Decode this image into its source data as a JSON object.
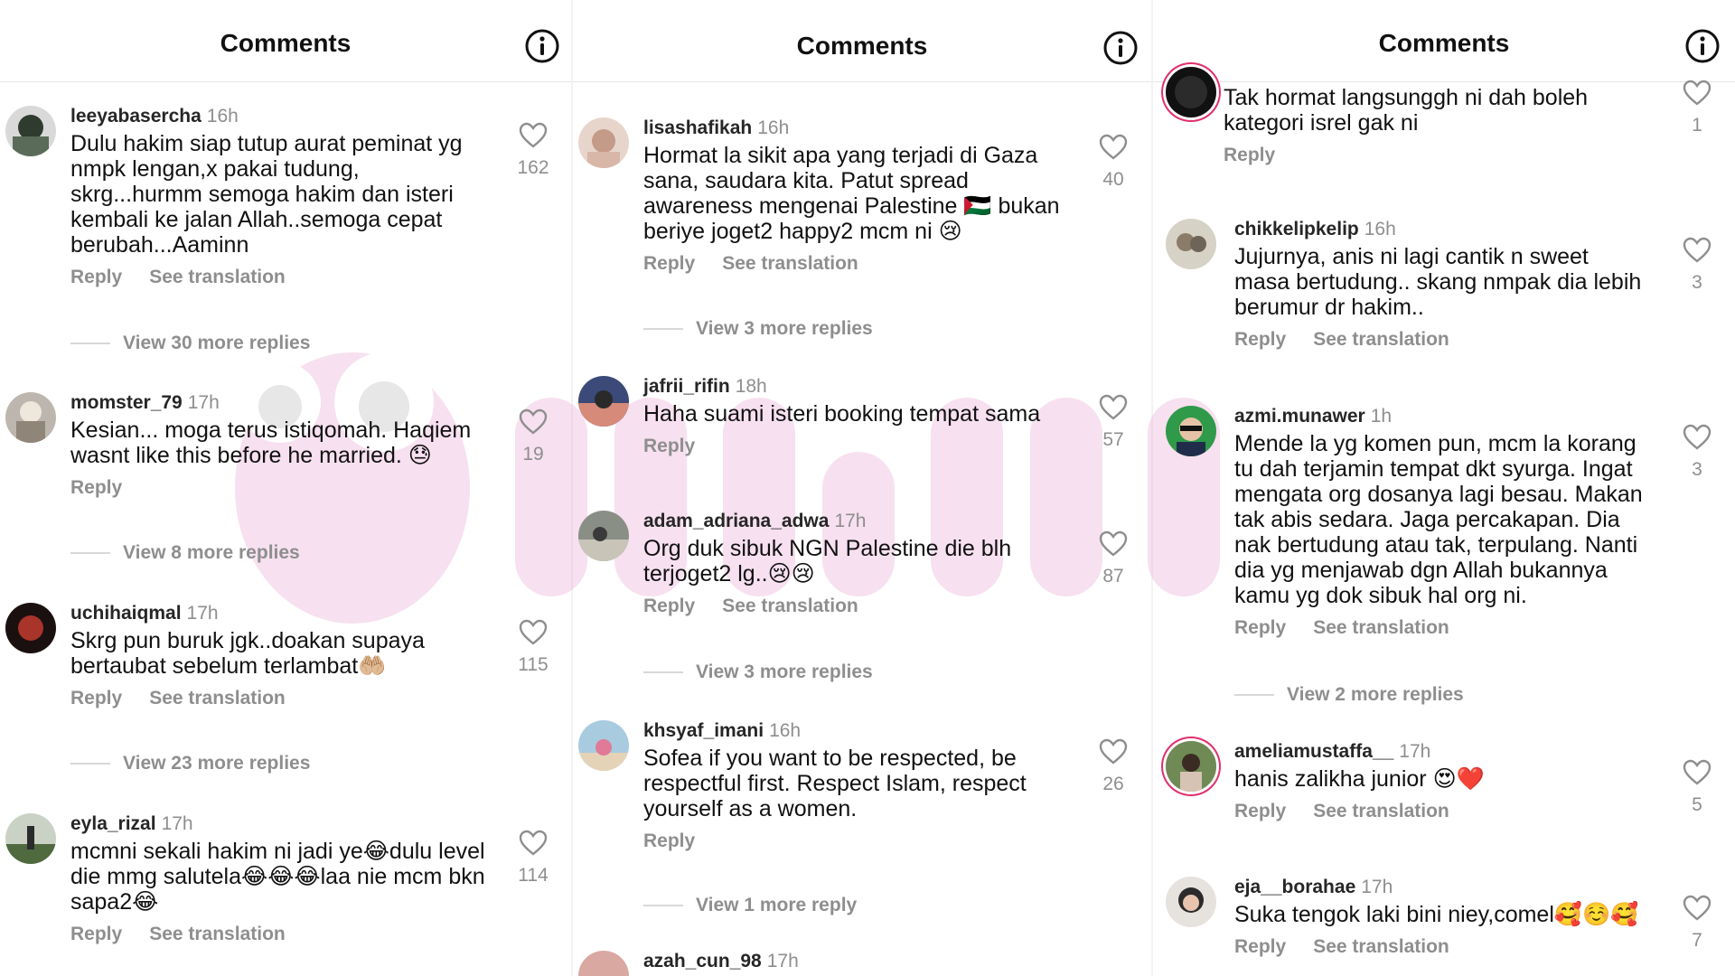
{
  "panels": [
    {
      "title": "Comments",
      "comments": [
        {
          "username": "leeyabasercha",
          "time": "16h",
          "text": "Dulu hakim siap tutup aurat peminat yg nmpk lengan,x pakai tudung, skrg...hurmm semoga hakim dan isteri kembali ke jalan Allah..semoga cepat berubah...Aaminn",
          "reply": "Reply",
          "translate": "See translation",
          "likes": "162",
          "view_more": "View 30 more replies"
        },
        {
          "username": "momster_79",
          "time": "17h",
          "text": "Kesian... moga terus istiqomah. Haqiem wasnt like this before he married. 😓",
          "reply": "Reply",
          "likes": "19",
          "view_more": "View 8 more replies"
        },
        {
          "username": "uchihaiqmal",
          "time": "17h",
          "text": "Skrg pun buruk jgk..doakan supaya bertaubat sebelum terlambat🤲🏼",
          "reply": "Reply",
          "translate": "See translation",
          "likes": "115",
          "view_more": "View 23 more replies"
        },
        {
          "username": "eyla_rizal",
          "time": "17h",
          "text": "mcmni sekali hakim ni jadi ye😂dulu level die mmg salutela😂😂😂laa nie mcm bkn sapa2😂",
          "reply": "Reply",
          "translate": "See translation",
          "likes": "114"
        }
      ]
    },
    {
      "title": "Comments",
      "comments": [
        {
          "username": "lisashafikah",
          "time": "16h",
          "text": "Hormat la sikit apa yang terjadi di Gaza sana, saudara kita. Patut spread awareness mengenai Palestine 🇵🇸 bukan beriye joget2 happy2 mcm ni 😢",
          "reply": "Reply",
          "translate": "See translation",
          "likes": "40",
          "view_more": "View 3 more replies"
        },
        {
          "username": "jafrii_rifin",
          "time": "18h",
          "text": "Haha suami isteri booking tempat sama",
          "reply": "Reply",
          "likes": "57"
        },
        {
          "username": "adam_adriana_adwa",
          "time": "17h",
          "text": "Org duk sibuk NGN Palestine die blh terjoget2 lg..😢😢",
          "reply": "Reply",
          "translate": "See translation",
          "likes": "87",
          "view_more": "View 3 more replies"
        },
        {
          "username": "khsyaf_imani",
          "time": "16h",
          "text": "Sofea if you want to be respected, be respectful first. Respect Islam, respect yourself as a women.",
          "reply": "Reply",
          "likes": "26",
          "view_more": "View 1 more reply"
        },
        {
          "username": "azah_cun_98",
          "time": "17h"
        }
      ]
    },
    {
      "title": "Comments",
      "comments": [
        {
          "text": "Tak hormat langsunggh ni dah boleh kategori isrel gak ni",
          "reply": "Reply",
          "likes": "1"
        },
        {
          "username": "chikkelipkelip",
          "time": "16h",
          "text": "Jujurnya, anis ni lagi cantik n sweet masa bertudung.. skang nmpak dia lebih berumur dr hakim..",
          "reply": "Reply",
          "translate": "See translation",
          "likes": "3"
        },
        {
          "username": "azmi.munawer",
          "time": "1h",
          "text": "Mende la yg komen pun, mcm la korang tu dah terjamin tempat dkt syurga. Ingat mengata org dosanya lagi besau. Makan tak abis sedara. Jaga percakapan. Dia nak bertudung atau tak, terpulang. Nanti dia yg menjawab dgn Allah bukannya kamu yg dok sibuk hal org ni.",
          "reply": "Reply",
          "translate": "See translation",
          "likes": "3",
          "view_more": "View 2 more replies"
        },
        {
          "username": "ameliamustaffa__",
          "time": "17h",
          "text": "hanis zalikha junior 😍❤️",
          "reply": "Reply",
          "translate": "See translation",
          "likes": "5"
        },
        {
          "username": "eja__borahae",
          "time": "17h",
          "text": "Suka tengok laki bini niey,comel🥰☺️🥰",
          "reply": "Reply",
          "translate": "See translation",
          "likes": "7"
        }
      ]
    }
  ],
  "icons": {
    "info": "info-circle-icon",
    "like": "heart-outline-icon"
  },
  "colors": {
    "muted": "#8e8e8e",
    "text": "#111111",
    "story_ring": "#e1306c",
    "watermark": "#e9a9d4"
  }
}
